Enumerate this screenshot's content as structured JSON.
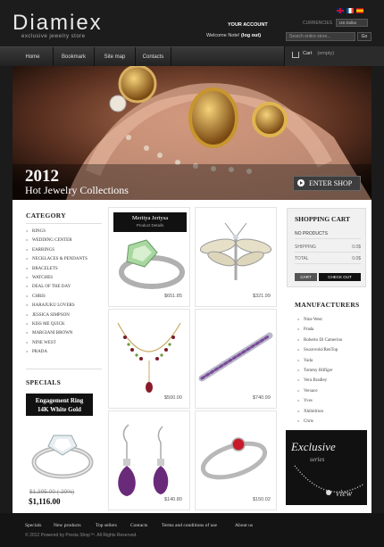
{
  "header": {
    "logo": "Diamiex",
    "tagline": "exclusive jewelry store",
    "account_title": "YOUR ACCOUNT",
    "welcome": "Welcome Note!",
    "login": "(log out)",
    "currencies_label": "CURRENCIES",
    "currency": "US Dollar",
    "search_placeholder": "Search entire store...",
    "go": "Go"
  },
  "nav": {
    "items": [
      "Home",
      "Bookmark",
      "Site map",
      "Contacts"
    ]
  },
  "cart_nav": {
    "label": "Cart",
    "status": "(empty)"
  },
  "hero": {
    "year": "2012",
    "subtitle": "Hot Jewelry Collections",
    "button": "ENTER SHOP"
  },
  "category": {
    "title": "CATEGORY",
    "items": [
      "RINGS",
      "WEDDING CENTER",
      "EARRINGS",
      "NECKLACES & PENDANTS",
      "BRACELETS",
      "WATCHES",
      "DEAL OF THE DAY",
      "CHRIS",
      "HARAJUKU LOVERS",
      "JESSICA SIMPSON",
      "KISS ME QUICK",
      "MARGIANI BROWN",
      "NINE WEST",
      "PRADA"
    ]
  },
  "specials": {
    "title": "SPECIALS",
    "name_line1": "Engagement Ring",
    "name_line2": "14K White Gold",
    "old_price": "$1,395.00 (-20%)",
    "new_price": "$1,116.00"
  },
  "featured": {
    "name": "Meritya Jertysa",
    "sub": "Product Details"
  },
  "products": [
    {
      "name": "green-gem-ring",
      "price": "$651.85"
    },
    {
      "name": "dragonfly-pendant",
      "price": "$321.99"
    },
    {
      "name": "gem-necklace",
      "price": "$500.00"
    },
    {
      "name": "tennis-bracelet",
      "price": "$740.99"
    },
    {
      "name": "amethyst-earrings",
      "price": "$140.80"
    },
    {
      "name": "ruby-ring",
      "price": "$150.02"
    }
  ],
  "shopping_cart": {
    "title": "SHOPPING CART",
    "empty": "NO PRODUCTS",
    "shipping_label": "SHIPPING",
    "shipping": "0.0$",
    "total_label": "TOTAL",
    "total": "0.0$",
    "cart_btn": "CART",
    "checkout_btn": "CHECK OUT"
  },
  "manufacturers": {
    "title": "MANUFACTURERS",
    "items": [
      "Nine West",
      "Prada",
      "Roberto Di Camerino",
      "Swarovski/RenTop",
      "Yada",
      "Tommy Hilfiger",
      "Vera Bradley",
      "Versace",
      "Yves",
      "Xhibitition",
      "Chris"
    ]
  },
  "exclusive": {
    "line1": "Exclusive",
    "line2": "series",
    "line3": "view"
  },
  "footer": {
    "links": [
      "Specials",
      "New products",
      "Top sellers",
      "Contacts",
      "Terms and conditions of use",
      "About us"
    ],
    "copyright": "© 2012 Powered by Presta Shop™. All Rights Reserved."
  },
  "colors": {
    "bg": "#1b1b1b",
    "accent": "#111111",
    "gold": "#c8962e"
  }
}
